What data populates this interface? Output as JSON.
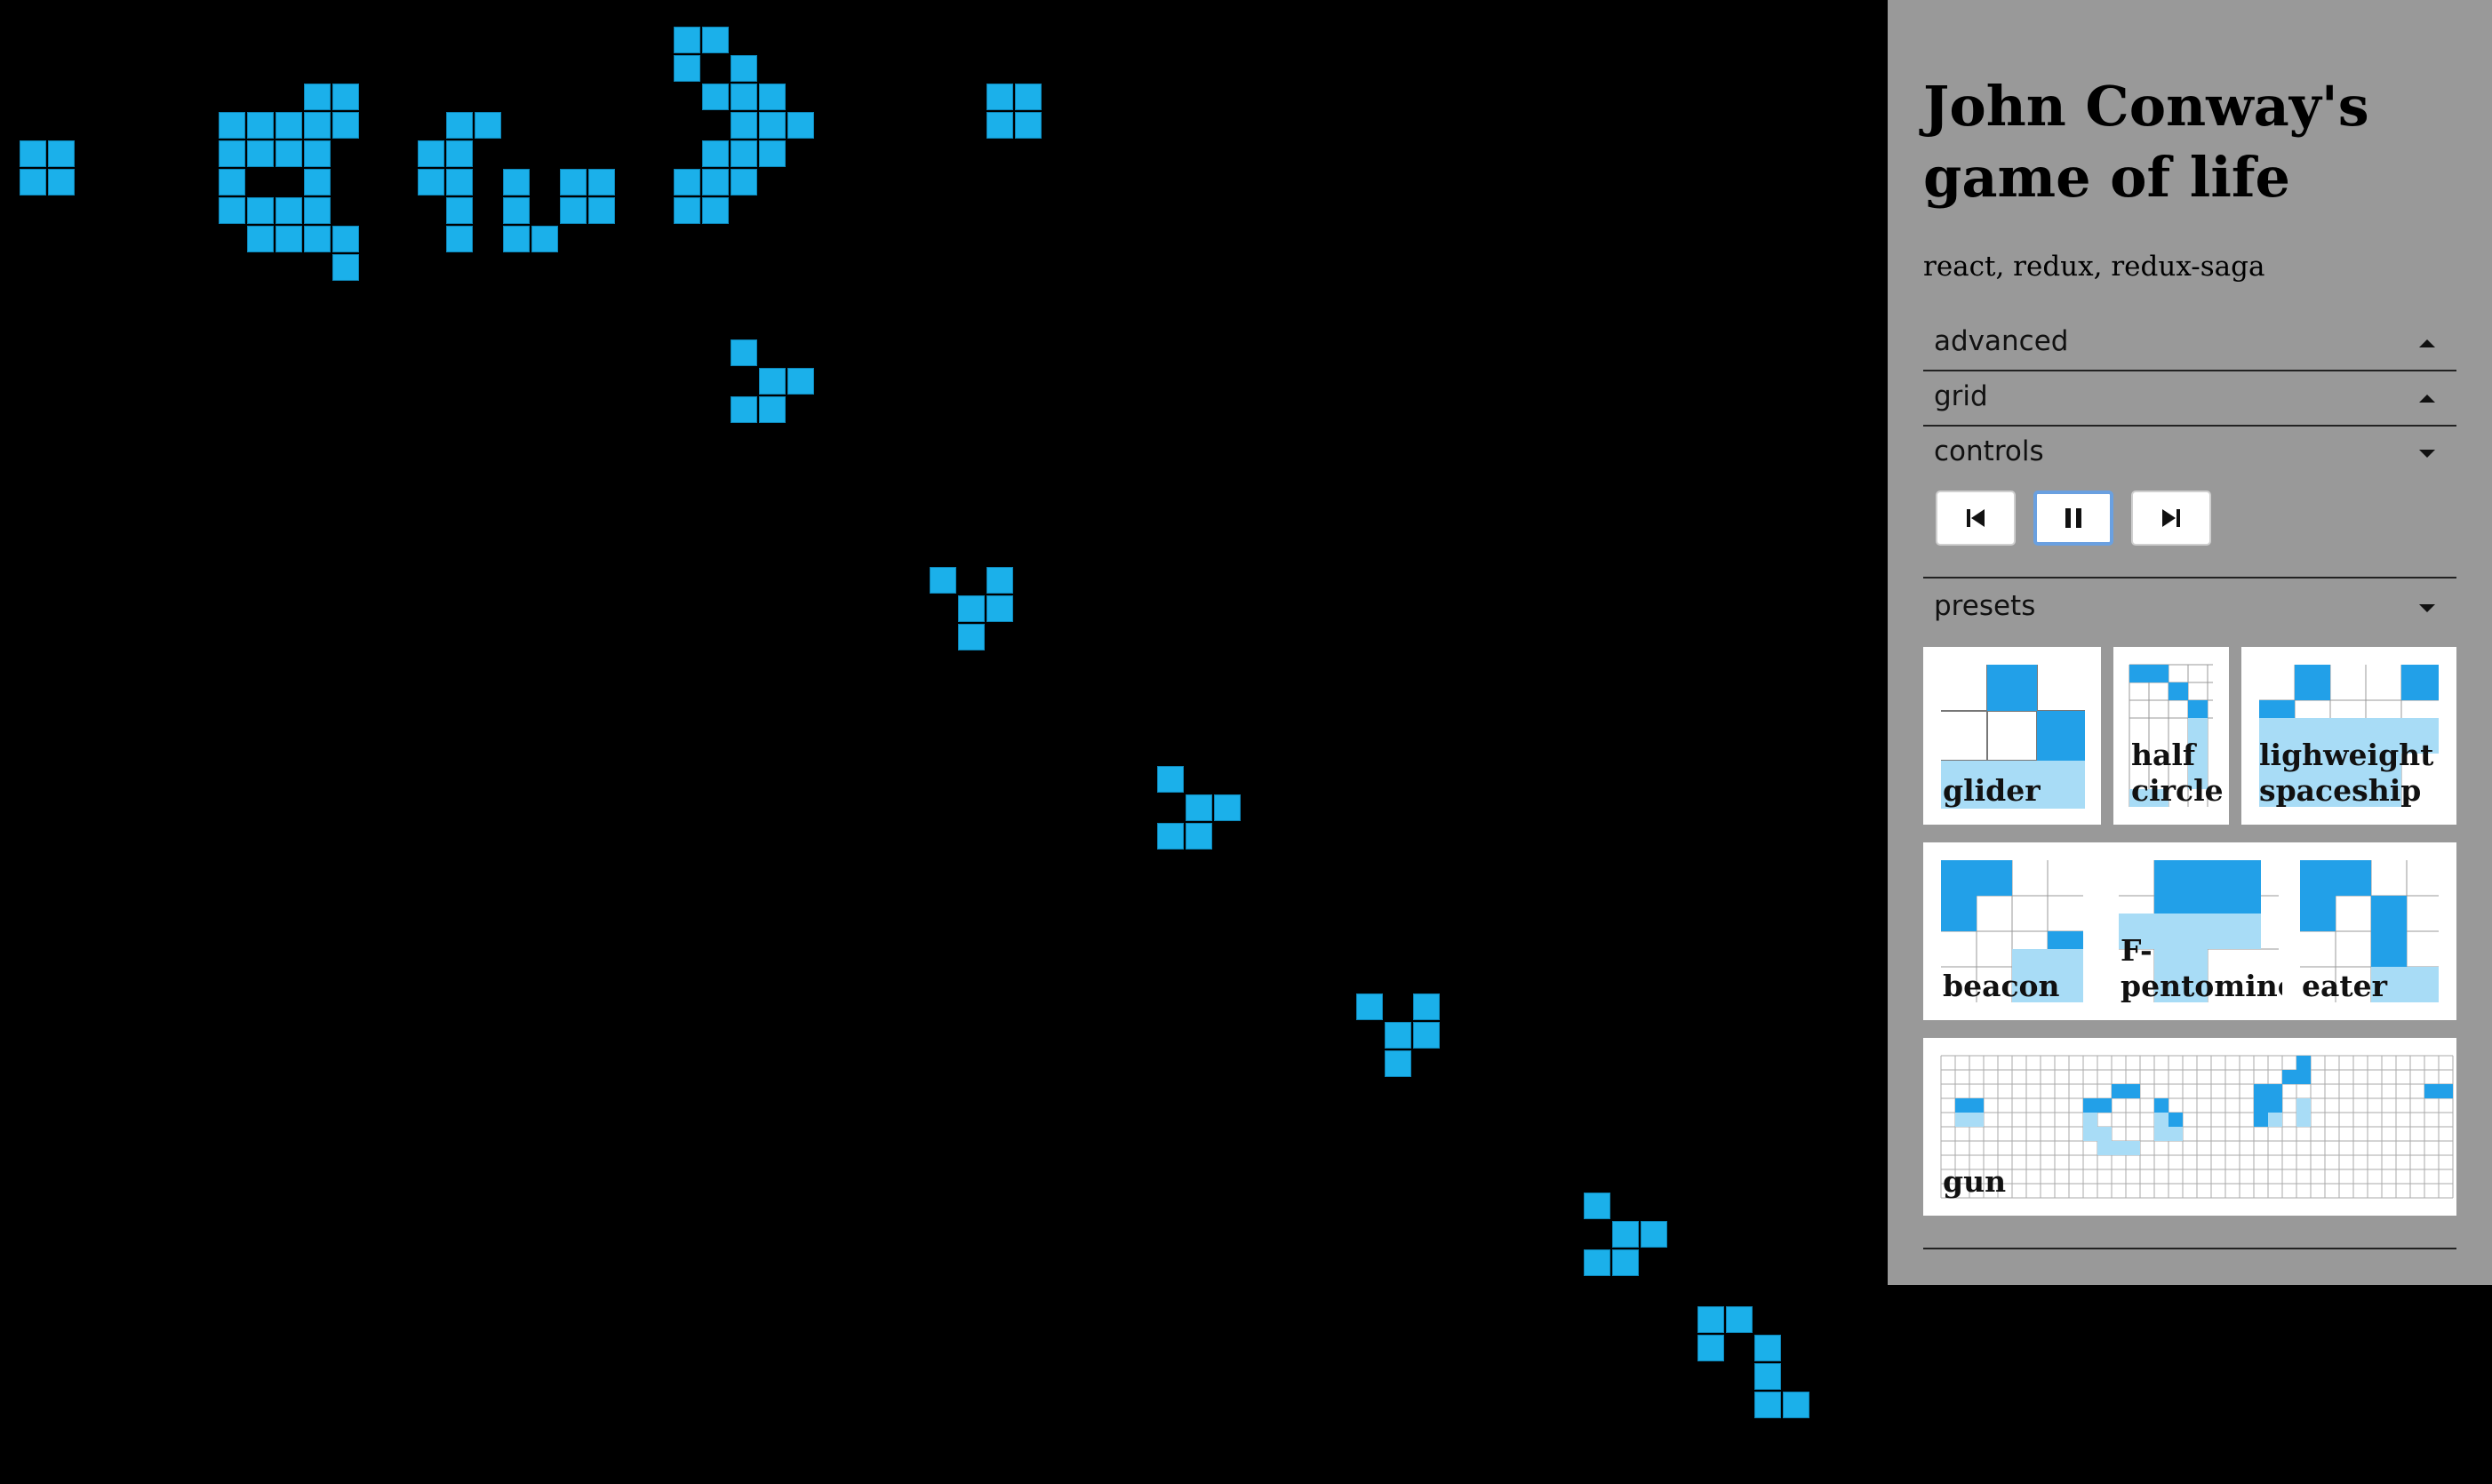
{
  "app": {
    "title": "John Conway's game of life",
    "subtitle": "react, redux, redux-saga"
  },
  "panel": {
    "sections": [
      {
        "label": "advanced",
        "state": "collapsed"
      },
      {
        "label": "grid",
        "state": "collapsed"
      },
      {
        "label": "controls",
        "state": "expanded"
      },
      {
        "label": "presets",
        "state": "expanded"
      }
    ],
    "controls": [
      {
        "icon": "skip-back-icon",
        "active": false
      },
      {
        "icon": "pause-icon",
        "active": true
      },
      {
        "icon": "skip-forward-icon",
        "active": false
      }
    ],
    "presets": [
      "glider",
      "half circle",
      "lighweight spaceship",
      "beacon",
      "F-pentomino",
      "eater",
      "gun"
    ]
  },
  "colors": {
    "cell": "#1bb0ea",
    "cell_outline": "#0d86b8",
    "board": "#000000",
    "panel": "#999999",
    "preset_dark": "#22a0e8",
    "preset_light": "#a8dcf6",
    "focus": "#6aa0e0"
  },
  "board": {
    "alive_cells": [
      [
        1,
        5
      ],
      [
        2,
        5
      ],
      [
        1,
        6
      ],
      [
        2,
        6
      ],
      [
        8,
        4
      ],
      [
        9,
        4
      ],
      [
        10,
        4
      ],
      [
        11,
        3
      ],
      [
        12,
        3
      ],
      [
        11,
        4
      ],
      [
        12,
        4
      ],
      [
        8,
        5
      ],
      [
        9,
        5
      ],
      [
        10,
        5
      ],
      [
        11,
        5
      ],
      [
        8,
        6
      ],
      [
        11,
        6
      ],
      [
        8,
        7
      ],
      [
        9,
        7
      ],
      [
        10,
        7
      ],
      [
        11,
        7
      ],
      [
        9,
        8
      ],
      [
        10,
        8
      ],
      [
        11,
        8
      ],
      [
        12,
        8
      ],
      [
        12,
        9
      ],
      [
        16,
        4
      ],
      [
        17,
        4
      ],
      [
        15,
        5
      ],
      [
        16,
        5
      ],
      [
        15,
        6
      ],
      [
        16,
        6
      ],
      [
        18,
        6
      ],
      [
        20,
        6
      ],
      [
        21,
        6
      ],
      [
        16,
        7
      ],
      [
        18,
        7
      ],
      [
        20,
        7
      ],
      [
        21,
        7
      ],
      [
        16,
        8
      ],
      [
        18,
        8
      ],
      [
        19,
        8
      ],
      [
        24,
        1
      ],
      [
        25,
        1
      ],
      [
        24,
        2
      ],
      [
        26,
        2
      ],
      [
        25,
        3
      ],
      [
        26,
        3
      ],
      [
        27,
        3
      ],
      [
        26,
        4
      ],
      [
        27,
        4
      ],
      [
        28,
        4
      ],
      [
        25,
        5
      ],
      [
        26,
        5
      ],
      [
        27,
        5
      ],
      [
        24,
        6
      ],
      [
        25,
        6
      ],
      [
        26,
        6
      ],
      [
        24,
        7
      ],
      [
        25,
        7
      ],
      [
        35,
        3
      ],
      [
        36,
        3
      ],
      [
        35,
        4
      ],
      [
        36,
        4
      ],
      [
        26,
        12
      ],
      [
        27,
        13
      ],
      [
        28,
        13
      ],
      [
        26,
        14
      ],
      [
        27,
        14
      ],
      [
        33,
        20
      ],
      [
        35,
        20
      ],
      [
        34,
        21
      ],
      [
        35,
        21
      ],
      [
        34,
        22
      ],
      [
        41,
        27
      ],
      [
        42,
        28
      ],
      [
        43,
        28
      ],
      [
        41,
        29
      ],
      [
        42,
        29
      ],
      [
        48,
        35
      ],
      [
        50,
        35
      ],
      [
        49,
        36
      ],
      [
        50,
        36
      ],
      [
        49,
        37
      ],
      [
        56,
        42
      ],
      [
        57,
        43
      ],
      [
        58,
        43
      ],
      [
        56,
        44
      ],
      [
        57,
        44
      ],
      [
        60,
        46
      ],
      [
        61,
        46
      ],
      [
        60,
        47
      ],
      [
        62,
        47
      ],
      [
        62,
        48
      ],
      [
        62,
        49
      ],
      [
        63,
        49
      ]
    ]
  }
}
